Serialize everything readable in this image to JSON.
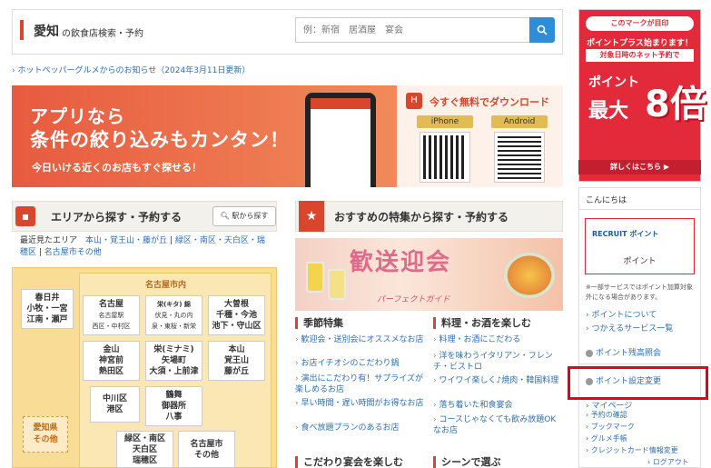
{
  "header": {
    "prefecture": "愛知",
    "subtitle": "の飲食店検索・予約",
    "search_placeholder": "例：新宿　居酒屋　宴会"
  },
  "notice": "ホットペッパーグルメからのお知らせ（2024年3月11日更新）",
  "app_banner": {
    "line1": "アプリなら",
    "line2": "条件の絞り込みもカンタン！",
    "line3": "今日いける近くのお店もすぐ探せる！",
    "download": "今すぐ無料でダウンロード",
    "iphone": "iPhone",
    "android": "Android",
    "icon_text": "H"
  },
  "area_section": {
    "title": "エリアから探す・予約する",
    "station_button": "駅から探す",
    "recent_label": "最近見たエリア",
    "recent_links": [
      "本山・覚王山・藤が丘",
      "緑区・南区・天白区・瑞穂区",
      "名古屋市その他"
    ],
    "nagoya_label": "名古屋市内",
    "areas": {
      "kasugai": [
        "春日井",
        "小牧・一宮",
        "江南・瀬戸"
      ],
      "meieki": [
        "名古屋",
        "名古屋駅",
        "西区・中村区"
      ],
      "sakae_fushimi": [
        "栄(キタ) 錦",
        "伏見・丸の内",
        "泉・東桜・新栄"
      ],
      "ozone": [
        "大曽根",
        "千種・今池",
        "池下・守山区"
      ],
      "kanayama": [
        "金山",
        "神宮前",
        "熱田区"
      ],
      "sakae_minami": [
        "栄(ミナミ)",
        "矢場町",
        "大須・上前津"
      ],
      "motoyama": [
        "本山",
        "覚王山",
        "藤が丘"
      ],
      "nakagawa": [
        "中川区",
        "港区"
      ],
      "tsurumai": [
        "鶴舞",
        "御器所",
        "八事"
      ],
      "midori": [
        "緑区・南区",
        "天白区",
        "瑞穂区"
      ],
      "nagoya_other": [
        "名古屋市",
        "その他"
      ],
      "pref_other": [
        "愛知県",
        "その他"
      ]
    }
  },
  "feature_section": {
    "title": "おすすめの特集から探す・予約する",
    "banner_title": "歓送迎会",
    "banner_sub": "パーフェクトガイド",
    "col1_title": "季節特集",
    "col1_links": [
      "歓迎会・送別会にオススメなお店",
      "お店イチオシのこだわり鍋",
      "演出にこだわり有！サプライズが楽しめるお店",
      "早い時間・遅い時間がお得なお店",
      "食べ放題プランのあるお店"
    ],
    "col2_title": "料理・お酒を楽しむ",
    "col2_links": [
      "料理・お酒にこだわる",
      "洋を味わうイタリアン・フレンチ・ビストロ",
      "ワイワイ楽しく♪焼肉・韓国料理",
      "落ち着いた和食宴会",
      "コースじゃなくても飲み放題OKなお店"
    ],
    "col3_title": "こだわり宴会を楽しむ",
    "col4_title": "シーンで選ぶ"
  },
  "sidebar": {
    "ad_top": "このマークが目印",
    "ad_l1": "ポイントプラス始まります！",
    "ad_l2": "対象日時のネット予約で",
    "ad_l3": "ポイント",
    "ad_l4": "最大",
    "ad_l5": "8倍",
    "ad_more": "詳しくはこちら ▶",
    "hello": "こんにちは",
    "recruit_logo": "RECRUIT ポイント",
    "point_label": "ポイント",
    "note": "※一部サービスではポイント加算対象外になる場合があります。",
    "links1": [
      "ポイントについて",
      "つかえるサービス一覧"
    ],
    "balance": "ポイント残高照会",
    "setting": "ポイント設定変更",
    "mypage": "マイページ",
    "links2": [
      "予約の確認",
      "ブックマーク",
      "グルメ手帳",
      "クレジットカード情報変更"
    ],
    "logout": "ログアウト"
  }
}
